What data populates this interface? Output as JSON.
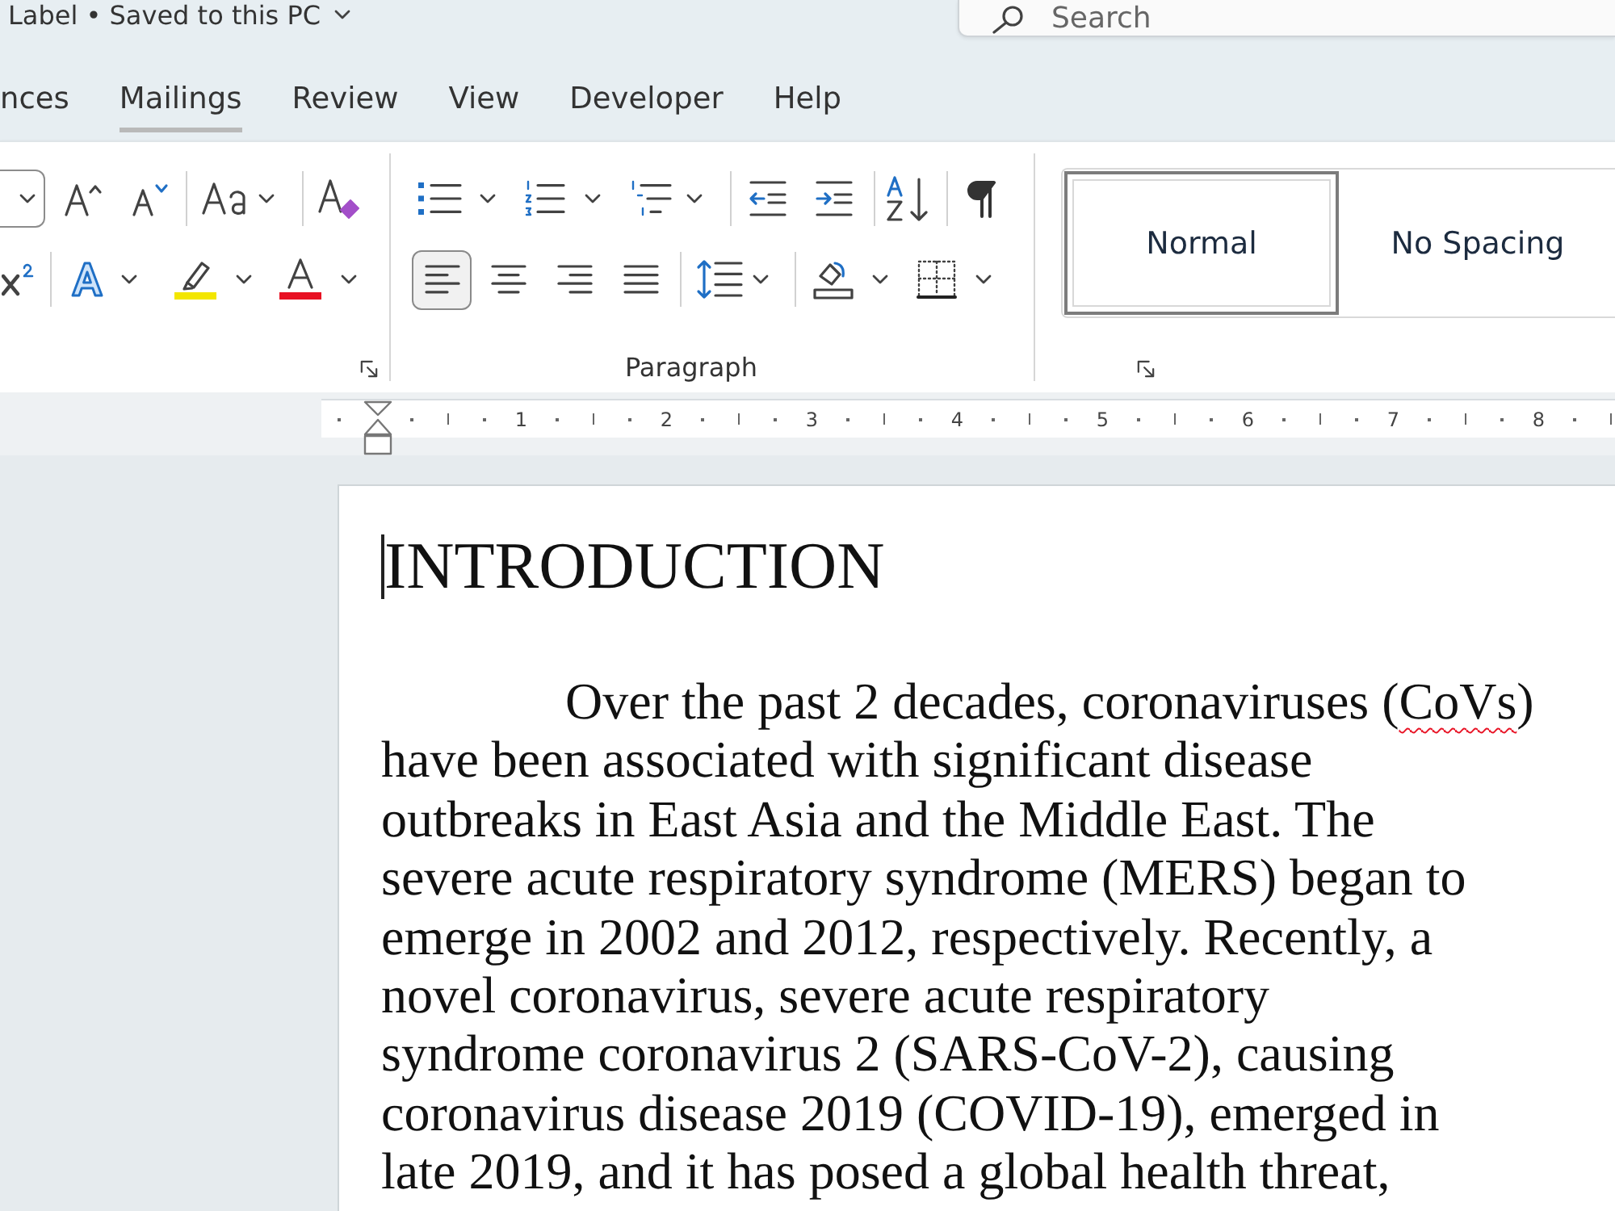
{
  "title_bar": {
    "title": "Label • Saved to this PC",
    "search": {
      "placeholder": "Search"
    }
  },
  "tabs": [
    {
      "label": "nces",
      "hovered": false
    },
    {
      "label": "Mailings",
      "hovered": true
    },
    {
      "label": "Review",
      "hovered": false
    },
    {
      "label": "View",
      "hovered": false
    },
    {
      "label": "Developer",
      "hovered": false
    },
    {
      "label": "Help",
      "hovered": false
    }
  ],
  "ribbon": {
    "paragraph_group": {
      "label": "Paragraph",
      "alignment_buttons": [
        {
          "kind": "left",
          "selected": true
        },
        {
          "kind": "center",
          "selected": false
        },
        {
          "kind": "right",
          "selected": false
        },
        {
          "kind": "justify",
          "selected": false
        }
      ]
    },
    "styles": [
      {
        "label": "Normal",
        "selected": true
      },
      {
        "label": "No Spacing",
        "selected": false
      }
    ]
  },
  "ruler": {
    "numbers": [
      "1",
      "2",
      "3",
      "4",
      "5",
      "6",
      "7",
      "8"
    ]
  },
  "document": {
    "heading": "INTRODUCTION",
    "caret_visible": true,
    "paragraph": {
      "lines": [
        [
          {
            "text": "Over the past 2 decades, coronaviruses (",
            "misspelled": false
          },
          {
            "text": "CoVs",
            "misspelled": true
          },
          {
            "text": ")",
            "misspelled": false
          }
        ],
        [
          {
            "text": "have been associated with significant disease",
            "misspelled": false
          }
        ],
        [
          {
            "text": "outbreaks in East Asia and the Middle East. The",
            "misspelled": false
          }
        ],
        [
          {
            "text": "severe acute respiratory syndrome (MERS) began to",
            "misspelled": false
          }
        ],
        [
          {
            "text": "emerge in 2002 and 2012, respectively. Recently, a",
            "misspelled": false
          }
        ],
        [
          {
            "text": "novel coronavirus, severe acute respiratory",
            "misspelled": false
          }
        ],
        [
          {
            "text": "syndrome coronavirus 2 (SARS-CoV-2), causing",
            "misspelled": false
          }
        ],
        [
          {
            "text": "coronavirus disease 2019 (COVID-19), emerged in",
            "misspelled": false
          }
        ],
        [
          {
            "text": "late 2019, and it has posed a global health threat,",
            "misspelled": false
          }
        ]
      ]
    }
  }
}
